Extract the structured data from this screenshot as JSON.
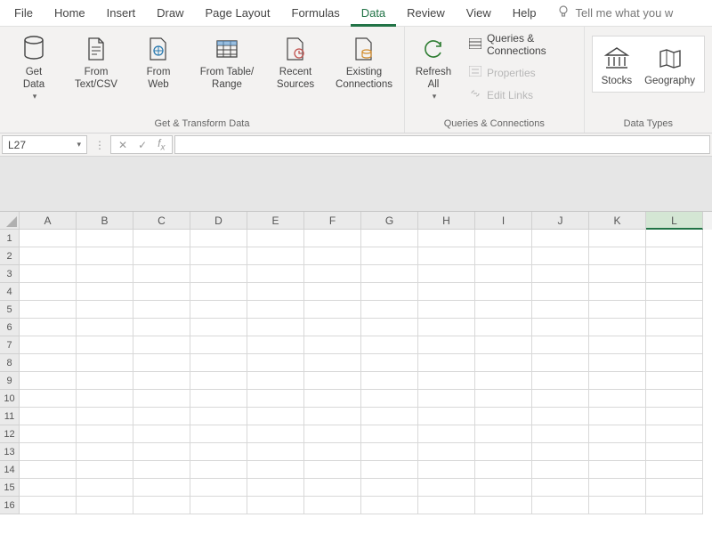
{
  "tabs": {
    "file": "File",
    "home": "Home",
    "insert": "Insert",
    "draw": "Draw",
    "page_layout": "Page Layout",
    "formulas": "Formulas",
    "data": "Data",
    "review": "Review",
    "view": "View",
    "help": "Help"
  },
  "tellme": {
    "placeholder": "Tell me what you w"
  },
  "ribbon": {
    "get_transform": {
      "label": "Get & Transform Data",
      "get_data": "Get\nData",
      "from_textcsv": "From\nText/CSV",
      "from_web": "From\nWeb",
      "from_table": "From Table/\nRange",
      "recent_sources": "Recent\nSources",
      "existing_conn": "Existing\nConnections"
    },
    "queries": {
      "label": "Queries & Connections",
      "refresh_all": "Refresh\nAll",
      "queries_conn": "Queries & Connections",
      "properties": "Properties",
      "edit_links": "Edit Links"
    },
    "data_types": {
      "label": "Data Types",
      "stocks": "Stocks",
      "geography": "Geography"
    }
  },
  "formula_bar": {
    "name_box": "L27"
  },
  "grid": {
    "columns": [
      "A",
      "B",
      "C",
      "D",
      "E",
      "F",
      "G",
      "H",
      "I",
      "J",
      "K",
      "L"
    ],
    "rows": [
      "1",
      "2",
      "3",
      "4",
      "5",
      "6",
      "7",
      "8",
      "9",
      "10",
      "11",
      "12",
      "13",
      "14",
      "15",
      "16"
    ],
    "selected_column": "L"
  }
}
